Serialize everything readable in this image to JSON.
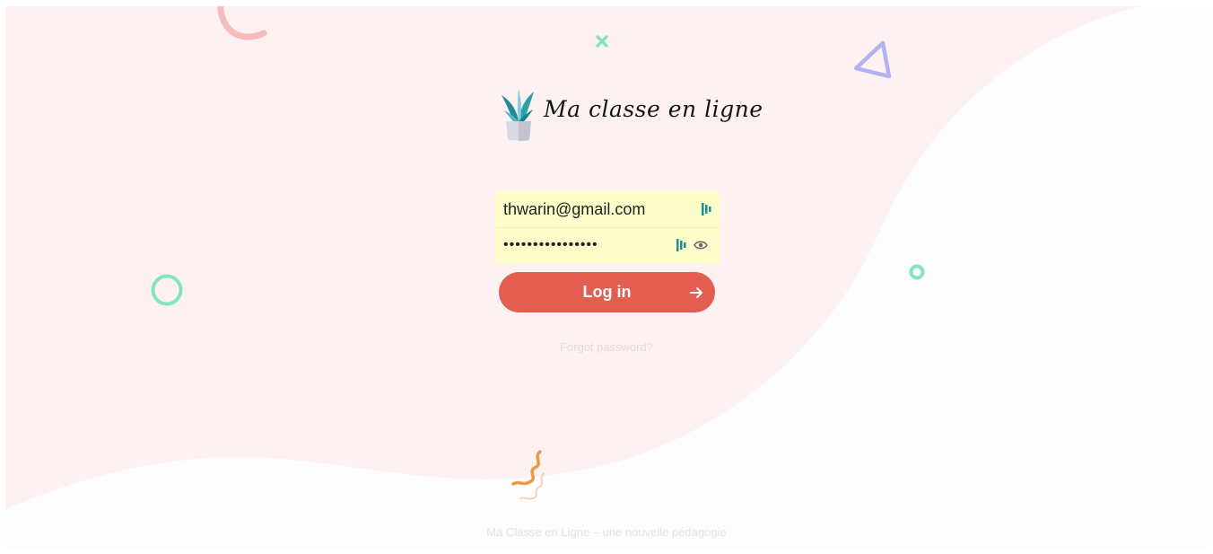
{
  "brand": {
    "name": "Ma classe en ligne"
  },
  "login_form": {
    "email": {
      "value": "thwarin@gmail.com"
    },
    "password": {
      "value": "••••••••••••••••"
    },
    "login_label": "Log in",
    "forgot_password_label": "Forgot password?"
  },
  "footer": {
    "text": "Ma Classe en Ligne – une nouvelle pédagogie"
  },
  "colors": {
    "background_pink": "#fdf1f1",
    "button_red": "#e35d51",
    "autofill_yellow": "#fcfdc8",
    "teal": "#1f8c98",
    "mint": "#86e3c0",
    "lavender": "#b3b1f0",
    "salmon": "#f5bcbb",
    "orange": "#e99a45"
  },
  "icons": {
    "logo": "potted-plant-icon",
    "password_manager": "password-manager-icon",
    "show_password": "eye-icon",
    "submit_arrow": "arrow-right-icon"
  }
}
